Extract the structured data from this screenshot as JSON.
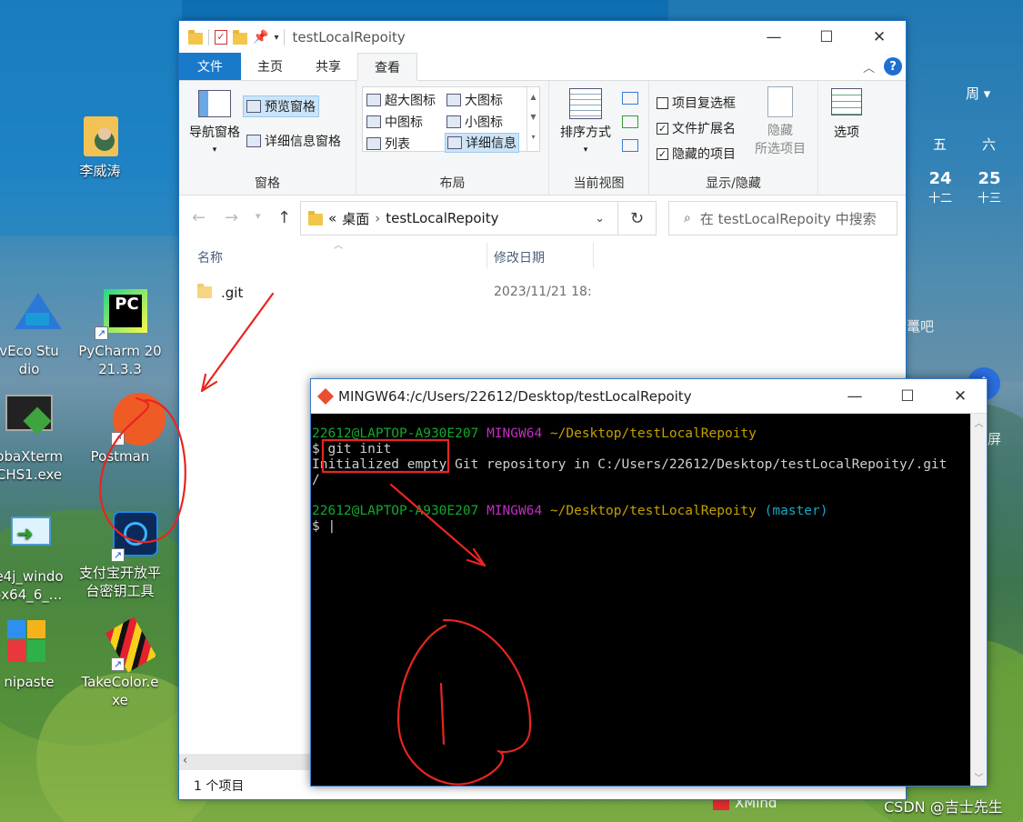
{
  "desktop": {
    "icons": [
      {
        "label": "李威涛",
        "icon": "user-folder-icon"
      },
      {
        "label": "vEco Stu\ndio",
        "icon": "deveco-studio-icon"
      },
      {
        "label": "PyCharm 20\n21.3.3",
        "icon": "pycharm-icon"
      },
      {
        "label": "bbaXterm\nCHS1.exe",
        "icon": "mobaxterm-icon"
      },
      {
        "label": "Postman",
        "icon": "postman-icon"
      },
      {
        "label": "e4j_windo\n-x64_6_...",
        "icon": "installer-icon"
      },
      {
        "label": "支付宝开放平\n台密钥工具",
        "icon": "alipay-key-tool-icon"
      },
      {
        "label": "nipaste",
        "icon": "snipaste-icon"
      },
      {
        "label": "TakeColor.e\nxe",
        "icon": "takecolor-icon"
      }
    ],
    "right_partial": {
      "week_label": "周",
      "day5": "五",
      "day6": "六",
      "num24": "24",
      "lunar24": "十二",
      "num25": "25",
      "lunar25": "十三",
      "side_text1": "鼍吧",
      "side_text2": "屏"
    },
    "xmind": "XMind",
    "watermark": "CSDN @吉士先生"
  },
  "explorer": {
    "title": "testLocalRepoity",
    "tabs": {
      "file": "文件",
      "home": "主页",
      "share": "共享",
      "view": "查看"
    },
    "ribbon": {
      "pane": {
        "nav_pane": "导航窗格",
        "preview_pane": "预览窗格",
        "details_pane": "详细信息窗格",
        "group": "窗格"
      },
      "layout": {
        "xl_icons": "超大图标",
        "large_icons": "大图标",
        "medium_icons": "中图标",
        "small_icons": "小图标",
        "list": "列表",
        "details": "详细信息",
        "group": "布局"
      },
      "current_view": {
        "sort_by": "排序方式",
        "group": "当前视图"
      },
      "show_hide": {
        "item_checkboxes": "项目复选框",
        "file_extensions": "文件扩展名",
        "hidden_items": "隐藏的项目",
        "hide_selected_1": "隐藏",
        "hide_selected_2": "所选项目",
        "group": "显示/隐藏"
      },
      "options": "选项"
    },
    "address": {
      "prefix": "«",
      "desktop": "桌面",
      "sep": "›",
      "current": "testLocalRepoity"
    },
    "search_placeholder": "在 testLocalRepoity 中搜索",
    "columns": {
      "name": "名称",
      "modified": "修改日期"
    },
    "files": [
      {
        "name": ".git",
        "modified": "2023/11/21 18:"
      }
    ],
    "status": "1 个项目"
  },
  "terminal": {
    "title": "MINGW64:/c/Users/22612/Desktop/testLocalRepoity",
    "lines": {
      "p1_user": "22612@LAPTOP-A930E207",
      "p1_sys": "MINGW64",
      "p1_path": "~/Desktop/testLocalRepoity",
      "cmd": "$ git init",
      "out1": "Initialized empty Git repository in C:/Users/22612/Desktop/testLocalRepoity/.git",
      "out2": "/",
      "p2_user": "22612@LAPTOP-A930E207",
      "p2_sys": "MINGW64",
      "p2_path": "~/Desktop/testLocalRepoity",
      "p2_branch": "(master)",
      "cursor": "$ |"
    }
  },
  "annotation": {
    "stroke_color": "#e8251f"
  }
}
